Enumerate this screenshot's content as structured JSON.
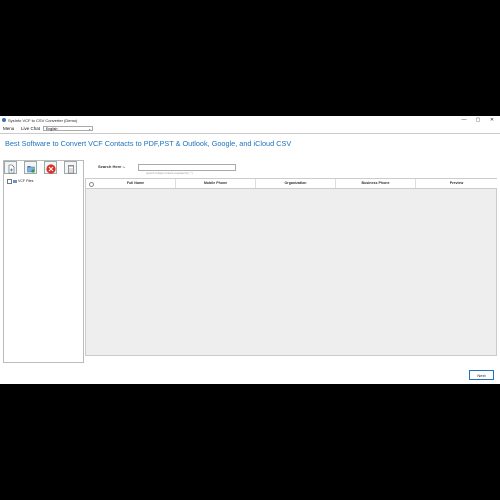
{
  "window": {
    "title": "SysInfo VCF to CSV Converter (Demo)",
    "controls": {
      "minimize": "—",
      "maximize": "▢",
      "close": "✕"
    }
  },
  "menubar": {
    "items": [
      "Menu",
      "Live Chat"
    ],
    "language": "English"
  },
  "heading": "Best Software to Convert VCF Contacts to PDF,PST & Outlook, Google, and iCloud CSV",
  "toolbar": {
    "buttons": [
      "add-file-icon",
      "add-folder-icon",
      "remove-icon",
      "clear-icon"
    ]
  },
  "tree": {
    "root": "VCF Files"
  },
  "search": {
    "label": "Search Here :-",
    "placeholder": "",
    "hint": "(search multiple contacts separated by \";\")"
  },
  "grid": {
    "columns": [
      "Full Name",
      "Mobile Phone",
      "Organization",
      "Business Phone",
      "Preview"
    ],
    "rows": []
  },
  "next_label": "Next",
  "colors": {
    "accent": "#1e73be",
    "close_red": "#d93025"
  }
}
